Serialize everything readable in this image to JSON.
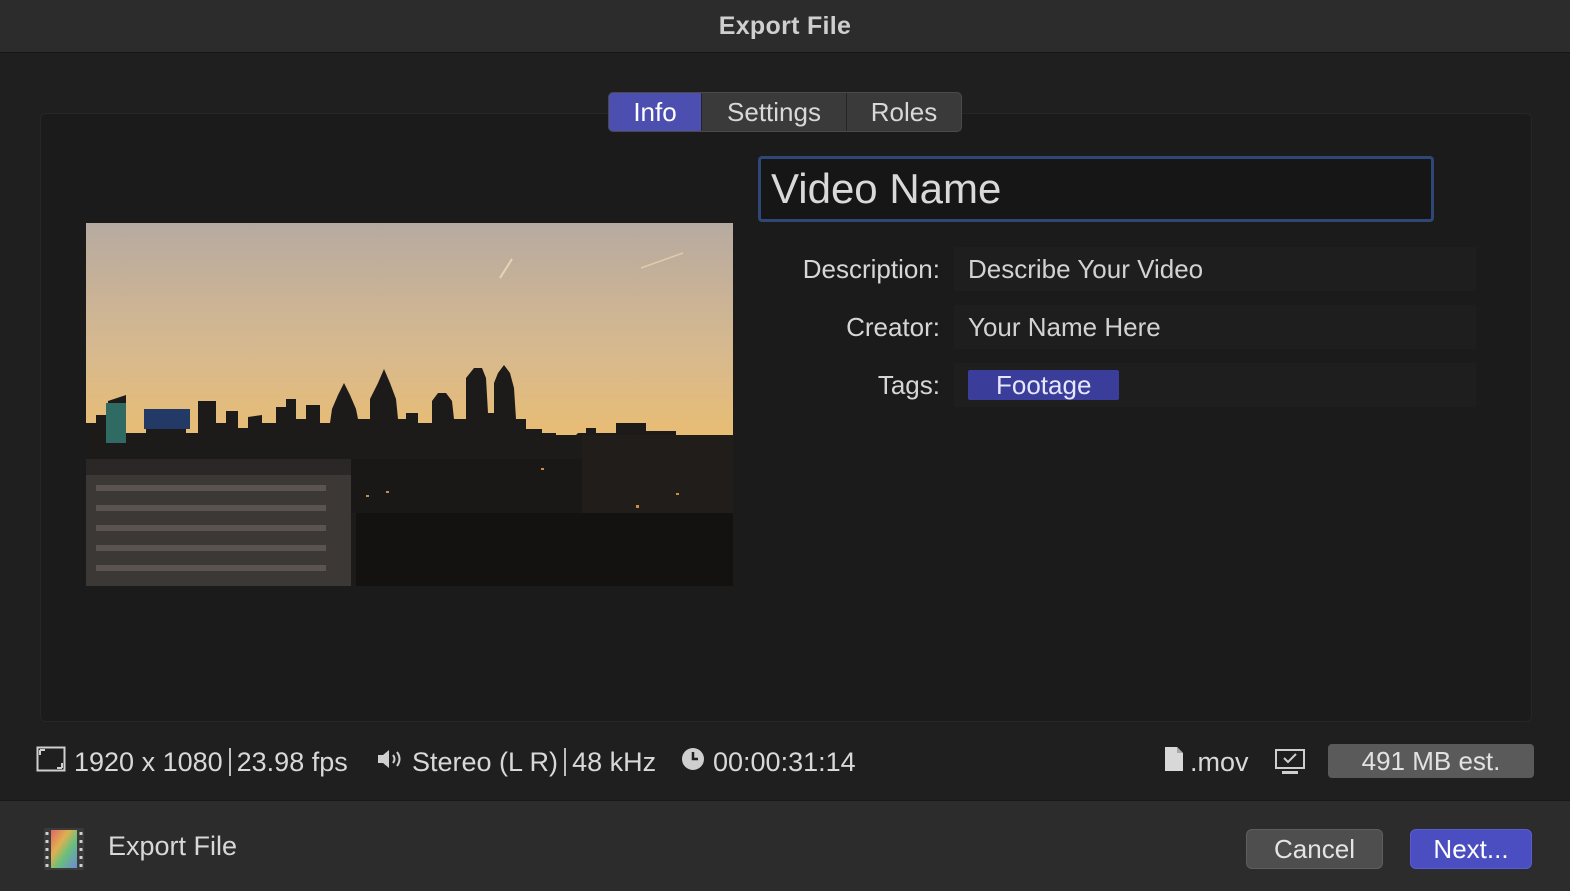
{
  "window": {
    "title": "Export File"
  },
  "tabs": [
    {
      "label": "Info",
      "active": true
    },
    {
      "label": "Settings",
      "active": false
    },
    {
      "label": "Roles",
      "active": false
    }
  ],
  "form": {
    "name_value": "Video Name",
    "description_label": "Description:",
    "description_value": "Describe Your Video",
    "creator_label": "Creator:",
    "creator_value": "Your Name Here",
    "tags_label": "Tags:",
    "tags": [
      "Footage"
    ]
  },
  "info": {
    "resolution": "1920 x 1080",
    "frame_rate": "23.98 fps",
    "audio_channels": "Stereo (L R)",
    "sample_rate": "48 kHz",
    "duration": "00:00:31:14",
    "format": ".mov",
    "size_estimate": "491 MB est."
  },
  "footer": {
    "label": "Export File",
    "cancel_label": "Cancel",
    "next_label": "Next..."
  },
  "icons": {
    "resolution": "frame-size-icon",
    "audio": "speaker-icon",
    "duration": "clock-icon",
    "file": "document-icon",
    "display": "display-icon",
    "export": "filmstrip-icon"
  },
  "colors": {
    "accent": "#4d4fb0",
    "tag": "#3a3d99",
    "focus_ring": "#2f4677"
  }
}
